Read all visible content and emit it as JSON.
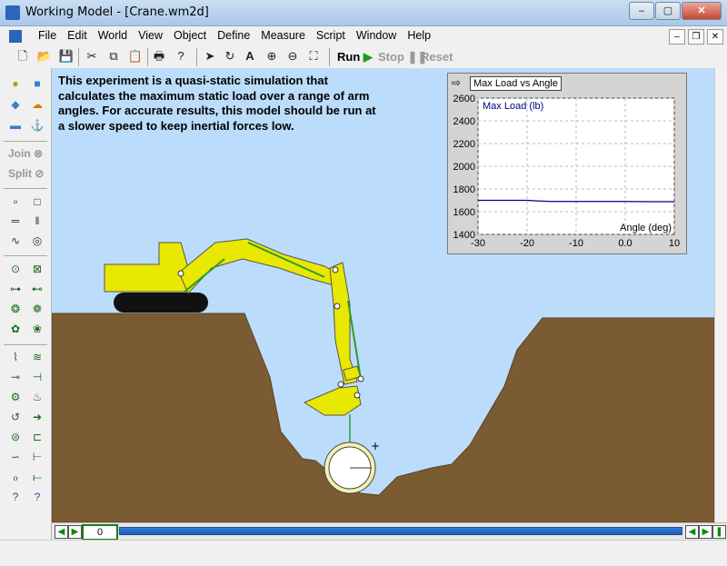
{
  "window": {
    "title": "Working Model - [Crane.wm2d]",
    "controls": [
      "–",
      "▢",
      "✕"
    ]
  },
  "menus": [
    "File",
    "Edit",
    "World",
    "View",
    "Object",
    "Define",
    "Measure",
    "Script",
    "Window",
    "Help"
  ],
  "toolbar": {
    "run_label": "Run",
    "stop_label": "Stop",
    "reset_label": "Reset"
  },
  "sidebar": {
    "join_label": "Join",
    "split_label": "Split"
  },
  "canvas": {
    "description": "This experiment is a quasi-static simulation that calculates the maximum static load over a range of arm angles. For accurate results, this model should be run at a slower speed to keep inertial forces low."
  },
  "chart_data": {
    "type": "line",
    "title": "Max Load vs Angle",
    "series": [
      {
        "name": "Max Load (lb)",
        "x": [
          -30,
          -25,
          -20,
          -18,
          -15,
          -10,
          -5,
          0,
          5,
          10
        ],
        "y": [
          1700,
          1700,
          1700,
          1695,
          1690,
          1690,
          1690,
          1690,
          1688,
          1688
        ]
      }
    ],
    "xlabel": "Angle (deg)",
    "ylabel": "Max Load (lb)",
    "xlim": [
      -30,
      10
    ],
    "ylim": [
      1400,
      2600
    ],
    "xticks": [
      "-30",
      "-20",
      "-10",
      "0.0",
      "10"
    ],
    "yticks": [
      "2600",
      "2400",
      "2200",
      "2000",
      "1800",
      "1600",
      "1400"
    ],
    "grid": true,
    "line_color": "#000080"
  },
  "playback": {
    "frame": "0"
  },
  "colors": {
    "sky": "#bcdcfb",
    "ground": "#7b5b32",
    "machine": "#e8e800",
    "spring": "#2c9a2c"
  }
}
